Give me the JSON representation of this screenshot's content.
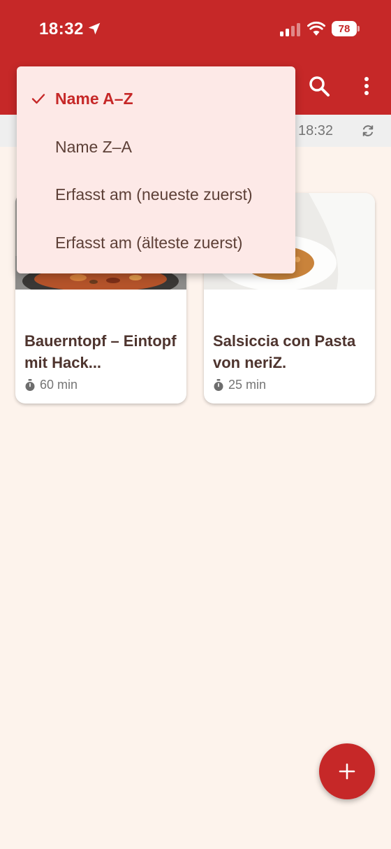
{
  "status_bar": {
    "time": "18:32",
    "battery": "78"
  },
  "app_bar": {
    "search_icon": "search-icon",
    "more_icon": "more-vert-icon"
  },
  "info_bar": {
    "sync_time": "18:32",
    "sync_icon": "sync-icon"
  },
  "sort_menu": {
    "items": [
      {
        "label": "Name A–Z",
        "selected": true
      },
      {
        "label": "Name Z–A",
        "selected": false
      },
      {
        "label": "Erfasst am (neueste zuerst)",
        "selected": false
      },
      {
        "label": "Erfasst am (älteste zuerst)",
        "selected": false
      }
    ]
  },
  "recipes": [
    {
      "title": "Bauerntopf – Eintopf mit Hack...",
      "time": "60 min"
    },
    {
      "title": "Salsiccia con Pasta von neriZ.",
      "time": "25 min"
    }
  ],
  "fab": {
    "icon": "plus-icon"
  },
  "colors": {
    "primary": "#c62828",
    "background": "#fdf3ec",
    "menu_background": "#fde9e7",
    "text": "#4e342e"
  }
}
